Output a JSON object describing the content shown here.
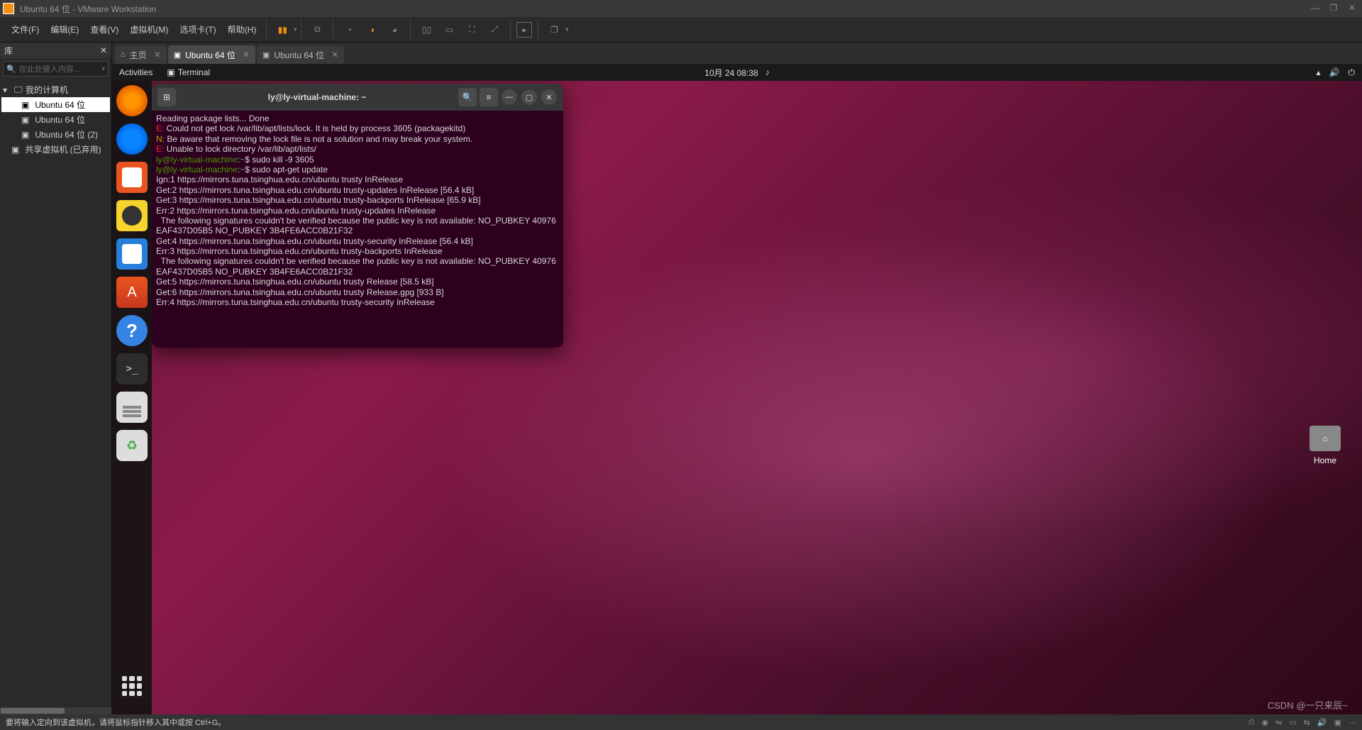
{
  "vmware": {
    "title": "Ubuntu 64 位 - VMware Workstation",
    "menu": [
      "文件(F)",
      "编辑(E)",
      "查看(V)",
      "虚拟机(M)",
      "选项卡(T)",
      "帮助(H)"
    ],
    "library_title": "库",
    "search_placeholder": "在此处键入内容...",
    "tree": {
      "root": "我的计算机",
      "items": [
        "Ubuntu 64 位",
        "Ubuntu 64 位",
        "Ubuntu 64 位 (2)",
        "共享虚拟机 (已弃用)"
      ]
    },
    "tabs": [
      {
        "label": "主页",
        "icon": "⌂"
      },
      {
        "label": "Ubuntu 64 位",
        "icon": "▣",
        "active": true
      },
      {
        "label": "Ubuntu 64 位",
        "icon": "▣"
      }
    ],
    "status": "要将输入定向到该虚拟机，请将鼠标指针移入其中或按 Ctrl+G。"
  },
  "ubuntu": {
    "activities": "Activities",
    "terminal_label": "Terminal",
    "datetime": "10月 24  08:38",
    "desktop_home": "Home"
  },
  "terminal": {
    "title": "ly@ly-virtual-machine: ~",
    "lines": [
      {
        "t": "Reading package lists... Done"
      },
      {
        "pre": "E: ",
        "cls": "err",
        "t": "Could not get lock /var/lib/apt/lists/lock. It is held by process 3605 (packagekitd)"
      },
      {
        "pre": "N: ",
        "cls": "warn",
        "t": "Be aware that removing the lock file is not a solution and may break your system."
      },
      {
        "pre": "E: ",
        "cls": "err",
        "t": "Unable to lock directory /var/lib/apt/lists/"
      },
      {
        "prompt": true,
        "cmd": "sudo kill -9 3605"
      },
      {
        "prompt": true,
        "cmd": "sudo apt-get update"
      },
      {
        "t": "Ign:1 https://mirrors.tuna.tsinghua.edu.cn/ubuntu trusty InRelease"
      },
      {
        "t": "Get:2 https://mirrors.tuna.tsinghua.edu.cn/ubuntu trusty-updates InRelease [56.4 kB]"
      },
      {
        "t": "Get:3 https://mirrors.tuna.tsinghua.edu.cn/ubuntu trusty-backports InRelease [65.9 kB]"
      },
      {
        "t": "Err:2 https://mirrors.tuna.tsinghua.edu.cn/ubuntu trusty-updates InRelease"
      },
      {
        "t": "  The following signatures couldn't be verified because the public key is not available: NO_PUBKEY 40976EAF437D05B5 NO_PUBKEY 3B4FE6ACC0B21F32"
      },
      {
        "t": "Get:4 https://mirrors.tuna.tsinghua.edu.cn/ubuntu trusty-security InRelease [56.4 kB]"
      },
      {
        "t": "Err:3 https://mirrors.tuna.tsinghua.edu.cn/ubuntu trusty-backports InRelease"
      },
      {
        "t": "  The following signatures couldn't be verified because the public key is not available: NO_PUBKEY 40976EAF437D05B5 NO_PUBKEY 3B4FE6ACC0B21F32"
      },
      {
        "t": "Get:5 https://mirrors.tuna.tsinghua.edu.cn/ubuntu trusty Release [58.5 kB]"
      },
      {
        "t": "Get:6 https://mirrors.tuna.tsinghua.edu.cn/ubuntu trusty Release.gpg [933 B]"
      },
      {
        "t": "Err:4 https://mirrors.tuna.tsinghua.edu.cn/ubuntu trusty-security InRelease"
      }
    ],
    "prompt_user": "ly@ly-virtual-machine",
    "prompt_path": "~"
  },
  "watermark": "CSDN @一只来辰~"
}
